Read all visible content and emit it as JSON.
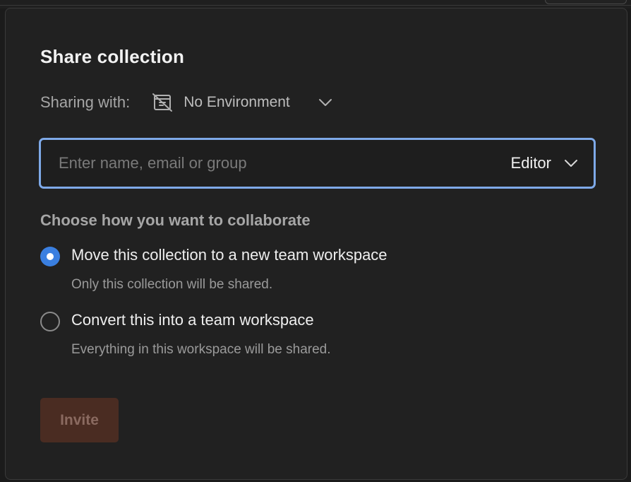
{
  "dialog": {
    "title": "Share collection"
  },
  "sharing": {
    "label": "Sharing with:",
    "environment": {
      "icon": "no-environment-icon",
      "name": "No Environment"
    }
  },
  "invite": {
    "placeholder": "Enter name, email or group",
    "value": "",
    "role": "Editor"
  },
  "collaborate": {
    "heading": "Choose how you want to collaborate",
    "options": [
      {
        "label": "Move this collection to a new team workspace",
        "description": "Only this collection will be shared.",
        "selected": true
      },
      {
        "label": "Convert this into a team workspace",
        "description": "Everything in this workspace will be shared.",
        "selected": false
      }
    ]
  },
  "actions": {
    "invite_label": "Invite",
    "invite_enabled": false
  },
  "colors": {
    "accent": "#3a7fe0",
    "focus_ring": "#7ea9e8",
    "disabled_button": "#4a2c22"
  }
}
